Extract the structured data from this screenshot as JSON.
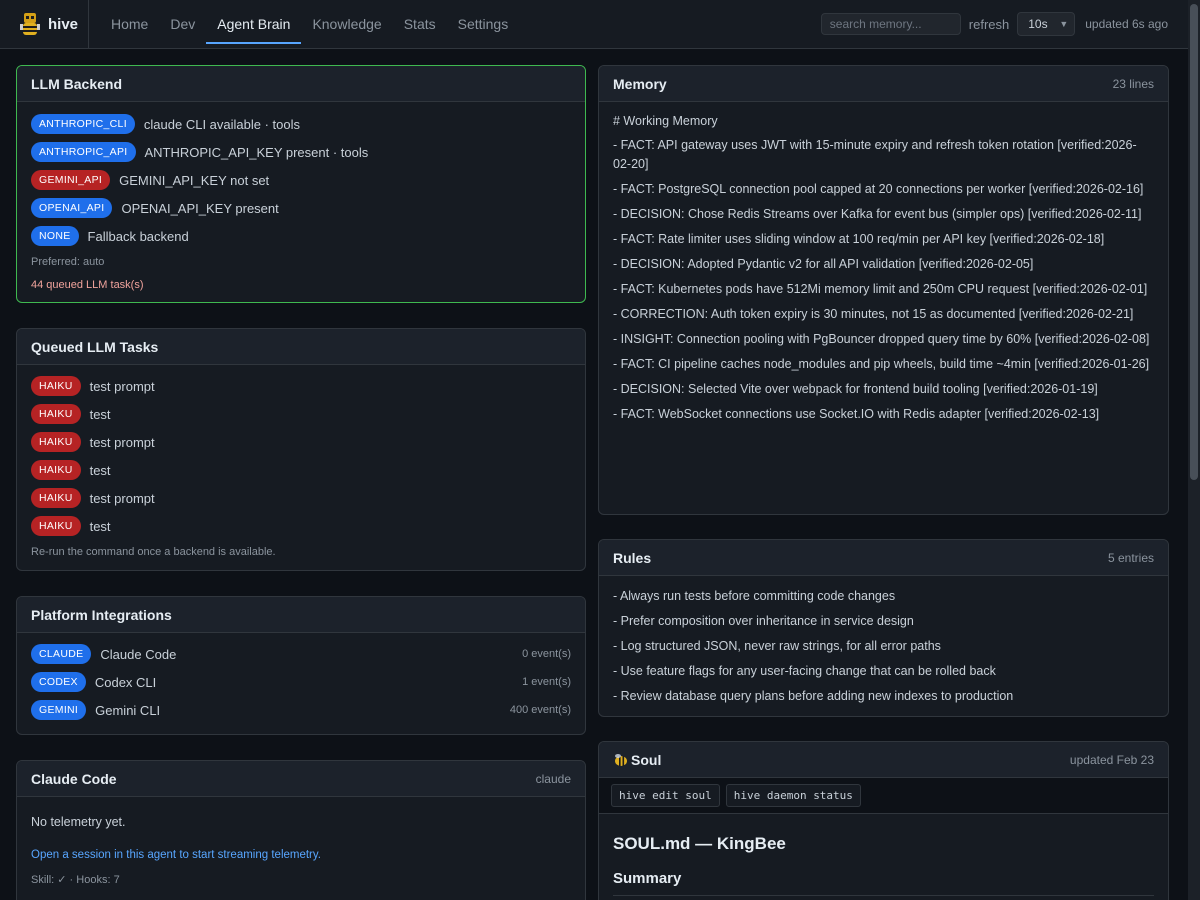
{
  "app": {
    "name": "hive"
  },
  "nav": {
    "items": [
      {
        "label": "Home"
      },
      {
        "label": "Dev"
      },
      {
        "label": "Agent Brain"
      },
      {
        "label": "Knowledge"
      },
      {
        "label": "Stats"
      },
      {
        "label": "Settings"
      }
    ],
    "active": "Agent Brain"
  },
  "toolbar": {
    "search_placeholder": "search memory...",
    "refresh_label": "refresh",
    "refresh_value": "10s",
    "updated": "updated 6s ago"
  },
  "llm_backend": {
    "title": "LLM Backend",
    "rows": [
      {
        "badge": "ANTHROPIC_CLI",
        "text": "claude CLI available · tools",
        "color": "blue"
      },
      {
        "badge": "ANTHROPIC_API",
        "text": "ANTHROPIC_API_KEY present · tools",
        "color": "blue"
      },
      {
        "badge": "GEMINI_API",
        "text": "GEMINI_API_KEY not set",
        "color": "red"
      },
      {
        "badge": "OPENAI_API",
        "text": "OPENAI_API_KEY present",
        "color": "blue"
      },
      {
        "badge": "NONE",
        "text": "Fallback backend",
        "color": "blue"
      }
    ],
    "preferred": "Preferred: auto",
    "queued": "44 queued LLM task(s)"
  },
  "queued_tasks": {
    "title": "Queued LLM Tasks",
    "rows": [
      {
        "badge": "HAIKU",
        "text": "test prompt"
      },
      {
        "badge": "HAIKU",
        "text": "test"
      },
      {
        "badge": "HAIKU",
        "text": "test prompt"
      },
      {
        "badge": "HAIKU",
        "text": "test"
      },
      {
        "badge": "HAIKU",
        "text": "test prompt"
      },
      {
        "badge": "HAIKU",
        "text": "test"
      }
    ],
    "note": "Re-run the command once a backend is available."
  },
  "platform": {
    "title": "Platform Integrations",
    "rows": [
      {
        "badge": "CLAUDE",
        "text": "Claude Code",
        "events": "0 event(s)"
      },
      {
        "badge": "CODEX",
        "text": "Codex CLI",
        "events": "1 event(s)"
      },
      {
        "badge": "GEMINI",
        "text": "Gemini CLI",
        "events": "400 event(s)"
      }
    ]
  },
  "claude_code": {
    "title": "Claude Code",
    "meta": "claude",
    "no_telemetry": "No telemetry yet.",
    "hint": "Open a session in this agent to start streaming telemetry.",
    "skill": "Skill: ✓ · Hooks: 7"
  },
  "memory": {
    "title": "Memory",
    "meta": "23 lines",
    "heading": "# Working Memory",
    "lines": [
      "- FACT: API gateway uses JWT with 15-minute expiry and refresh token rotation [verified:2026-02-20]",
      "- FACT: PostgreSQL connection pool capped at 20 connections per worker [verified:2026-02-16]",
      "- DECISION: Chose Redis Streams over Kafka for event bus (simpler ops) [verified:2026-02-11]",
      "- FACT: Rate limiter uses sliding window at 100 req/min per API key [verified:2026-02-18]",
      "- DECISION: Adopted Pydantic v2 for all API validation [verified:2026-02-05]",
      "- FACT: Kubernetes pods have 512Mi memory limit and 250m CPU request [verified:2026-02-01]",
      "- CORRECTION: Auth token expiry is 30 minutes, not 15 as documented [verified:2026-02-21]",
      "- INSIGHT: Connection pooling with PgBouncer dropped query time by 60% [verified:2026-02-08]",
      "- FACT: CI pipeline caches node_modules and pip wheels, build time ~4min [verified:2026-01-26]",
      "- DECISION: Selected Vite over webpack for frontend build tooling [verified:2026-01-19]",
      "- FACT: WebSocket connections use Socket.IO with Redis adapter [verified:2026-02-13]"
    ]
  },
  "rules": {
    "title": "Rules",
    "meta": "5 entries",
    "lines": [
      "- Always run tests before committing code changes",
      "- Prefer composition over inheritance in service design",
      "- Log structured JSON, never raw strings, for all error paths",
      "- Use feature flags for any user-facing change that can be rolled back",
      "- Review database query plans before adding new indexes to production"
    ]
  },
  "soul": {
    "title": "Soul",
    "meta": "updated Feb 23",
    "commands": [
      "hive edit soul",
      "hive daemon status"
    ],
    "doc_title": "SOUL.md — KingBee",
    "summary": "Summary"
  }
}
